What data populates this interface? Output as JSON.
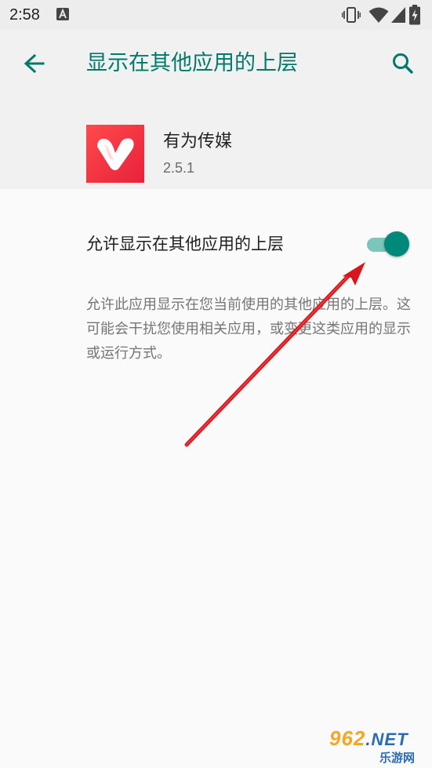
{
  "status_bar": {
    "time": "2:58",
    "notification_icon": "a-letter-icon",
    "vibrate_icon": "vibrate-icon",
    "wifi_icon": "wifi-icon",
    "signal_icon": "cell-signal-icon",
    "battery_icon": "battery-charging-icon"
  },
  "header": {
    "title": "显示在其他应用的上层",
    "back_icon": "arrow-back-icon",
    "search_icon": "search-icon",
    "accent_color": "#00796b"
  },
  "app": {
    "name": "有为传媒",
    "version": "2.5.1",
    "icon": "heart-v-logo",
    "icon_color": "#e8213b"
  },
  "permission": {
    "toggle_label": "允许显示在其他应用的上层",
    "toggle_on": true,
    "toggle_color": "#00897b",
    "description": "允许此应用显示在您当前使用的其他应用的上层。这可能会干扰您使用相关应用，或变更这类应用的显示或运行方式。"
  },
  "annotation": {
    "arrow_color": "#d9161c"
  },
  "watermark": {
    "line1_digits": "962",
    "line1_suffix": ".NET",
    "line2": "乐游网"
  }
}
